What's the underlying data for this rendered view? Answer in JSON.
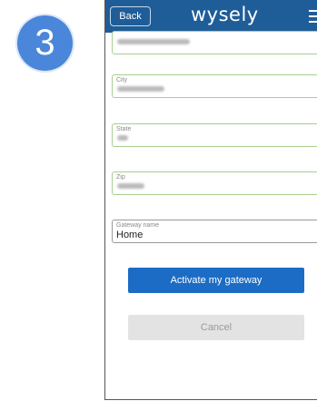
{
  "step": {
    "number": "3"
  },
  "header": {
    "back_label": "Back",
    "brand": "wysely"
  },
  "form": {
    "fields": [
      {
        "label": "",
        "value": ""
      },
      {
        "label": "City",
        "value": ""
      },
      {
        "label": "State",
        "value": ""
      },
      {
        "label": "Zip",
        "value": ""
      },
      {
        "label": "Gateway name",
        "value": "Home"
      }
    ],
    "primary_button": "Activate my gateway",
    "cancel_button": "Cancel"
  },
  "colors": {
    "header": "#1f5d99",
    "primary": "#1c6cc5",
    "badge": "#4a86d9",
    "field_border": "#a7cf8e"
  }
}
